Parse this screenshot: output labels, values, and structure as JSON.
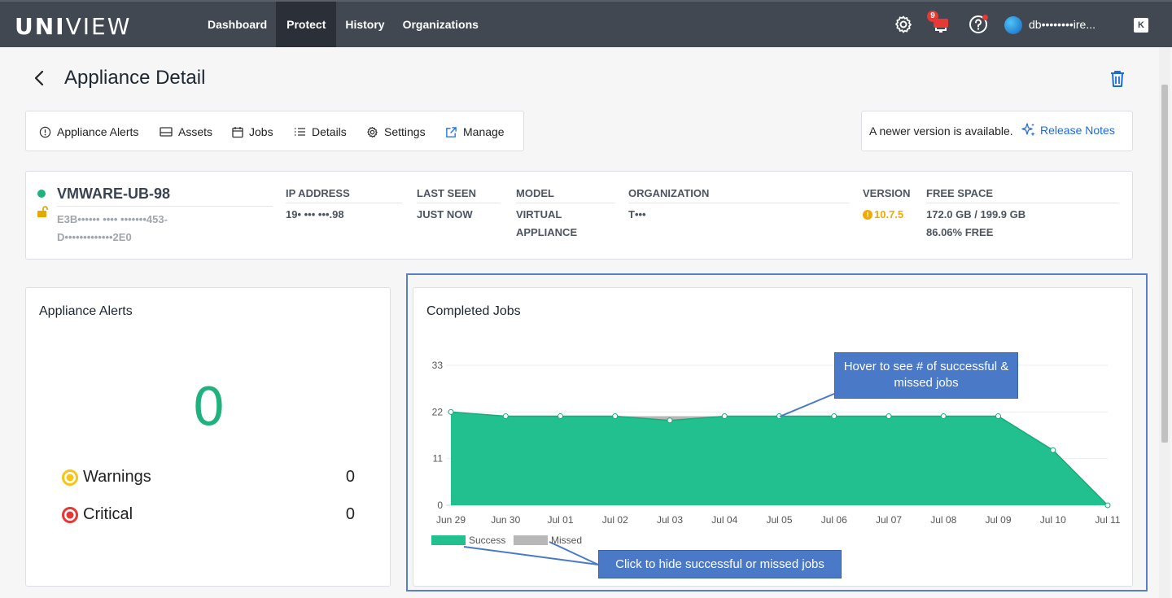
{
  "app": {
    "logo_bold": "UNI",
    "logo_light": "VIEW",
    "nav": [
      {
        "label": "Dashboard",
        "active": false
      },
      {
        "label": "Protect",
        "active": true
      },
      {
        "label": "History",
        "active": false
      },
      {
        "label": "Organizations",
        "active": false
      }
    ],
    "notifications_count": "9",
    "username": "db••••••••ire...",
    "k_button": "K"
  },
  "page": {
    "title": "Appliance Detail"
  },
  "toolbar": {
    "items": [
      {
        "label": "Appliance Alerts",
        "icon": "alert-circle-icon"
      },
      {
        "label": "Assets",
        "icon": "drive-icon"
      },
      {
        "label": "Jobs",
        "icon": "calendar-icon"
      },
      {
        "label": "Details",
        "icon": "list-icon"
      },
      {
        "label": "Settings",
        "icon": "gear-icon"
      },
      {
        "label": "Manage",
        "icon": "external-link-icon"
      }
    ]
  },
  "update": {
    "text": "A newer version is available.",
    "link": "Release Notes"
  },
  "appliance": {
    "name": "VMWARE-UB-98",
    "id_line1": "E3B•••••• •••• •••••••453-",
    "id_line2": "D•••••••••••••2E0",
    "ip_label": "IP ADDRESS",
    "ip_value": "19• ••• •••.98",
    "last_seen_label": "LAST SEEN",
    "last_seen_value": "JUST NOW",
    "model_label": "MODEL",
    "model_value_1": "VIRTUAL",
    "model_value_2": "APPLIANCE",
    "org_label": "ORGANIZATION",
    "org_value": "T•••",
    "version_label": "VERSION",
    "version_value": "10.7.5",
    "free_label": "FREE SPACE",
    "free_value": "172.0 GB / 199.9 GB",
    "free_pct": "86.06% FREE"
  },
  "alerts": {
    "title": "Appliance Alerts",
    "total": "0",
    "rows": [
      {
        "label": "Warnings",
        "count": "0",
        "color": "#f5c518"
      },
      {
        "label": "Critical",
        "count": "0",
        "color": "#e53935"
      }
    ]
  },
  "jobs": {
    "title": "Completed Jobs",
    "callout_hover": "Hover to see # of successful & missed jobs",
    "callout_legend": "Click to hide successful or missed jobs"
  },
  "chart_data": {
    "type": "area",
    "title": "Completed Jobs",
    "categories": [
      "Jun 29",
      "Jun 30",
      "Jul 01",
      "Jul 02",
      "Jul 03",
      "Jul 04",
      "Jul 05",
      "Jul 06",
      "Jul 07",
      "Jul 08",
      "Jul 09",
      "Jul 10",
      "Jul 11"
    ],
    "series": [
      {
        "name": "Success",
        "values": [
          22,
          21,
          21,
          21,
          20,
          21,
          21,
          21,
          21,
          21,
          21,
          13,
          0
        ],
        "color": "#22c08e"
      },
      {
        "name": "Missed",
        "values": [
          0,
          0,
          0,
          0,
          1,
          0,
          0,
          0,
          0,
          0,
          0,
          0,
          0
        ],
        "color": "#b7b7b7"
      }
    ],
    "stacked": true,
    "yticks": [
      0,
      11,
      22,
      33
    ],
    "ylim": [
      0,
      33
    ],
    "grid": true,
    "legend": "bottom-left"
  }
}
